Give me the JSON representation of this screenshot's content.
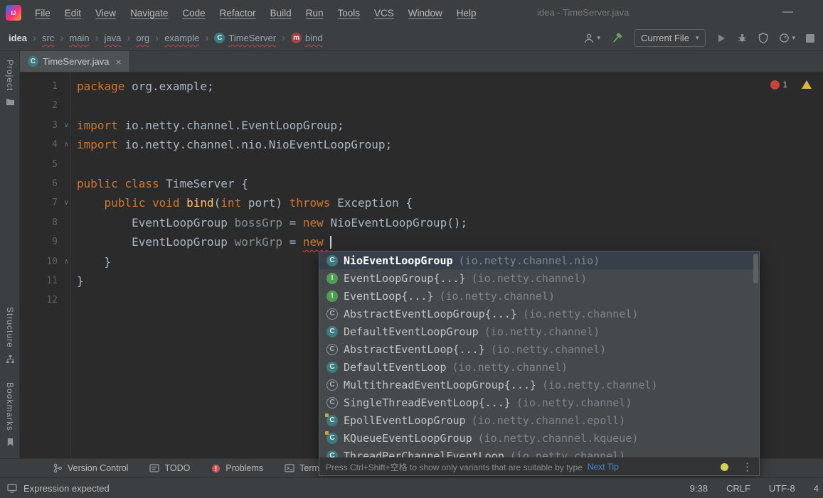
{
  "icons": {
    "chevron": "›",
    "caret_down": "▾",
    "close": "×",
    "minimize": "—",
    "kebab": "⋮"
  },
  "title_bar": {
    "menus": [
      "File",
      "Edit",
      "View",
      "Navigate",
      "Code",
      "Refactor",
      "Build",
      "Run",
      "Tools",
      "VCS",
      "Window",
      "Help"
    ],
    "window_title": "idea - TimeServer.java"
  },
  "nav_bar": {
    "breadcrumbs": [
      {
        "label": "idea",
        "kind": "root"
      },
      {
        "label": "src"
      },
      {
        "label": "main"
      },
      {
        "label": "java"
      },
      {
        "label": "org"
      },
      {
        "label": "example"
      },
      {
        "label": "TimeServer",
        "icon": "class"
      },
      {
        "label": "bind",
        "icon": "method"
      }
    ],
    "run_config_label": "Current File"
  },
  "tab_bar": {
    "tabs": [
      {
        "label": "TimeServer.java",
        "active": true
      }
    ]
  },
  "tool_strip": {
    "top": [
      {
        "label": "Project",
        "icon": "project"
      }
    ],
    "bottom": [
      {
        "label": "Structure",
        "icon": "structure"
      },
      {
        "label": "Bookmarks",
        "icon": "bookmarks"
      }
    ]
  },
  "editor": {
    "error_badge": "1",
    "lines": [
      {
        "n": 1,
        "seg": [
          [
            "kw",
            "package "
          ],
          [
            "pl",
            "org.example;"
          ]
        ]
      },
      {
        "n": 2,
        "seg": []
      },
      {
        "n": 3,
        "fold": "start",
        "seg": [
          [
            "kw",
            "import "
          ],
          [
            "pl",
            "io.netty.channel.EventLoopGroup;"
          ]
        ]
      },
      {
        "n": 4,
        "fold": "end",
        "seg": [
          [
            "kw",
            "import "
          ],
          [
            "pl",
            "io.netty.channel.nio.NioEventLoopGroup;"
          ]
        ]
      },
      {
        "n": 5,
        "seg": []
      },
      {
        "n": 6,
        "seg": [
          [
            "kw",
            "public class "
          ],
          [
            "pl",
            "TimeServer {"
          ]
        ]
      },
      {
        "n": 7,
        "fold": "start",
        "seg": [
          [
            "pl",
            "    "
          ],
          [
            "kw",
            "public void "
          ],
          [
            "fn",
            "bind"
          ],
          [
            "pl",
            "("
          ],
          [
            "kw",
            "int"
          ],
          [
            "pl",
            " port) "
          ],
          [
            "kw",
            "throws"
          ],
          [
            "pl",
            " Exception {"
          ]
        ]
      },
      {
        "n": 8,
        "seg": [
          [
            "pl",
            "        "
          ],
          [
            "pl",
            "EventLoopGroup "
          ],
          [
            "var",
            "bossGrp"
          ],
          [
            "pl",
            " = "
          ],
          [
            "kw",
            "new "
          ],
          [
            "pl",
            "NioEventLoopGroup();"
          ]
        ]
      },
      {
        "n": 9,
        "caret": true,
        "seg": [
          [
            "pl",
            "        "
          ],
          [
            "pl",
            "EventLoopGroup "
          ],
          [
            "var",
            "workGrp"
          ],
          [
            "pl",
            " = "
          ],
          [
            "kwerr",
            "new "
          ]
        ]
      },
      {
        "n": 10,
        "fold": "end",
        "seg": [
          [
            "pl",
            "    }"
          ]
        ]
      },
      {
        "n": 11,
        "seg": [
          [
            "pl",
            "}"
          ]
        ]
      },
      {
        "n": 12,
        "seg": []
      }
    ]
  },
  "completion": {
    "items": [
      {
        "icon": "class",
        "name": "NioEventLoopGroup",
        "pkg": "(io.netty.channel.nio)",
        "selected": true
      },
      {
        "icon": "interface",
        "name": "EventLoopGroup{...}",
        "pkg": "(io.netty.channel)"
      },
      {
        "icon": "interface",
        "name": "EventLoop{...}",
        "pkg": "(io.netty.channel)"
      },
      {
        "icon": "abstract",
        "name": "AbstractEventLoopGroup{...}",
        "pkg": "(io.netty.channel)"
      },
      {
        "icon": "class",
        "name": "DefaultEventLoopGroup",
        "pkg": "(io.netty.channel)"
      },
      {
        "icon": "abstract",
        "name": "AbstractEventLoop{...}",
        "pkg": "(io.netty.channel)"
      },
      {
        "icon": "class",
        "name": "DefaultEventLoop",
        "pkg": "(io.netty.channel)"
      },
      {
        "icon": "abstract",
        "name": "MultithreadEventLoopGroup{...}",
        "pkg": "(io.netty.channel)"
      },
      {
        "icon": "abstract",
        "name": "SingleThreadEventLoop{...}",
        "pkg": "(io.netty.channel)"
      },
      {
        "icon": "class-marked",
        "name": "EpollEventLoopGroup",
        "pkg": "(io.netty.channel.epoll)"
      },
      {
        "icon": "class-marked",
        "name": "KQueueEventLoopGroup",
        "pkg": "(io.netty.channel.kqueue)"
      },
      {
        "icon": "class",
        "name": "ThreadPerChannelEventLoop",
        "pkg": "(io.netty.channel)"
      }
    ],
    "hint": "Press Ctrl+Shift+空格 to show only variants that are suitable by type",
    "next_tip": "Next Tip"
  },
  "bottom_bar": {
    "items": [
      {
        "label": "Version Control",
        "icon": "vcs"
      },
      {
        "label": "TODO",
        "icon": "todo"
      },
      {
        "label": "Problems",
        "icon": "problems"
      },
      {
        "label": "Terminal",
        "icon": "terminal"
      }
    ]
  },
  "status_bar": {
    "message": "Expression expected",
    "caret_position": "9:38",
    "line_separator": "CRLF",
    "encoding": "UTF-8",
    "indent": "4"
  }
}
